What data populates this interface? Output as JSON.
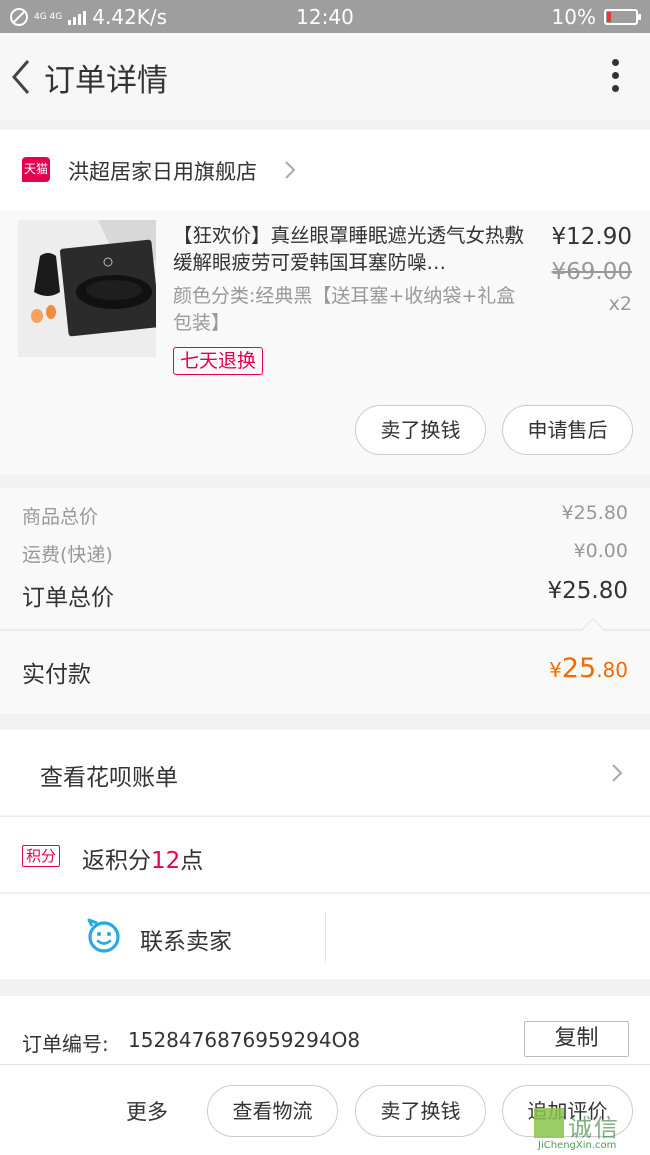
{
  "status_bar": {
    "net_label": "4G 4G",
    "speed": "4.42K/s",
    "time": "12:40",
    "battery": "10%",
    "battery_level": 0.1
  },
  "nav": {
    "title": "订单详情",
    "back_icon": "back-chevron-icon",
    "more_icon": "more-vertical-icon"
  },
  "store": {
    "badge": "天猫",
    "name": "洪超居家日用旗舰店"
  },
  "product": {
    "title": "【狂欢价】真丝眼罩睡眠遮光透气女热敷缓解眼疲劳可爱韩国耳塞防噪…",
    "spec": "颜色分类:经典黑【送耳塞+收纳袋+礼盒包装】",
    "tag": "七天退换",
    "price": "¥12.90",
    "original_price": "¥69.00",
    "quantity": "x2",
    "actions": [
      "卖了换钱",
      "申请售后"
    ]
  },
  "summary": {
    "goods_total_label": "商品总价",
    "goods_total": "¥25.80",
    "shipping_label": "运费(快递)",
    "shipping": "¥0.00",
    "order_total_label": "订单总价",
    "order_total": "¥25.80"
  },
  "paid": {
    "label": "实付款",
    "currency": "¥",
    "integer": "25",
    "decimal": ".80"
  },
  "huabei": {
    "label": "查看花呗账单"
  },
  "points": {
    "badge": "积分",
    "prefix": "返积分",
    "value": "12",
    "suffix": "点"
  },
  "contact": {
    "label": "联系卖家",
    "icon": "chat-smiley-icon"
  },
  "order": {
    "number_label": "订单编号:",
    "number": "1528476876959294O8",
    "copy_label": "复制"
  },
  "bottom_bar": {
    "more": "更多",
    "buttons": [
      "查看物流",
      "卖了换钱",
      "追加评价"
    ]
  },
  "watermark": {
    "text": "诚信",
    "url": "JiChengXin.com"
  },
  "colors": {
    "accent": "#e5004f",
    "paid_orange": "#f56a00",
    "status_bar": "#9e9e9e",
    "contact_blue": "#29a9e0"
  }
}
